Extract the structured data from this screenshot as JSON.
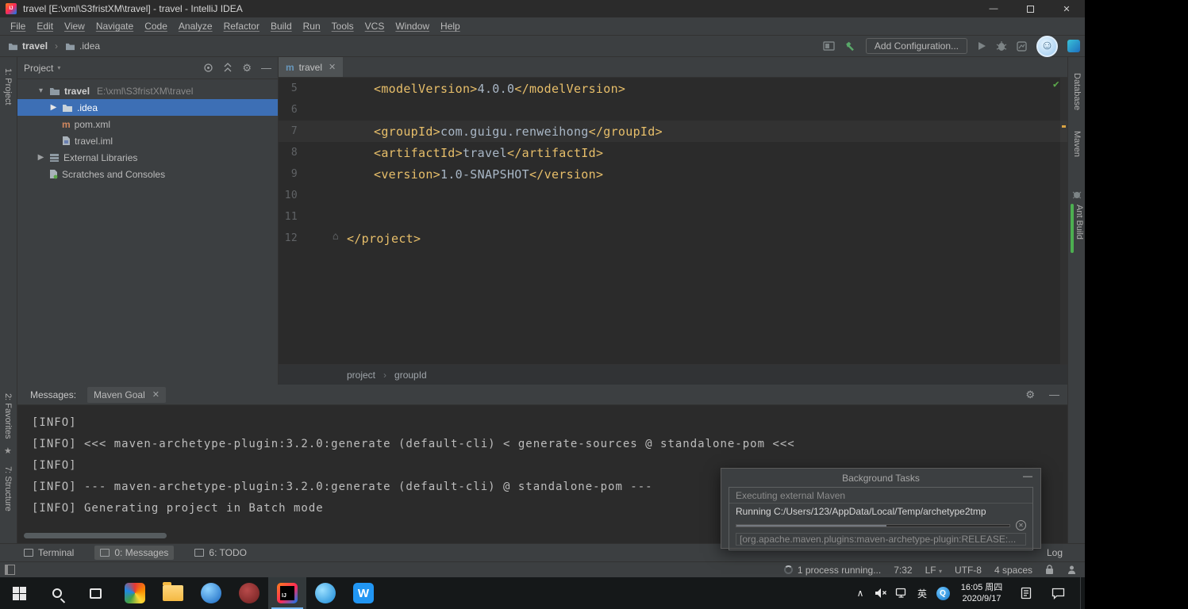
{
  "colors": {
    "xml-tag": "#e8bf6a",
    "code-text": "#a9b7c6",
    "ok-green": "#5ba74a",
    "bulb-yellow": "#f3c53f",
    "taskbar-accent": "#75b6f1"
  },
  "title_bar": {
    "title": "travel [E:\\xml\\S3fristXM\\travel] - travel - IntelliJ IDEA"
  },
  "menu_bar": {
    "items": [
      "File",
      "Edit",
      "View",
      "Navigate",
      "Code",
      "Analyze",
      "Refactor",
      "Build",
      "Run",
      "Tools",
      "VCS",
      "Window",
      "Help"
    ]
  },
  "nav_bar": {
    "crumb_project": "travel",
    "crumb_folder": ".idea",
    "add_configuration_label": "Add Configuration..."
  },
  "left_stripe": {
    "project": "1: Project",
    "favorites": "2: Favorites",
    "structure": "7: Structure"
  },
  "right_stripe": {
    "database": "Database",
    "maven": "Maven",
    "ant_build": "Ant Build"
  },
  "project_panel": {
    "header_label": "Project",
    "tree": [
      {
        "label": "travel",
        "hint": "E:\\xml\\S3fristXM\\travel"
      },
      {
        "label": ".idea"
      },
      {
        "label": "pom.xml"
      },
      {
        "label": "travel.iml"
      },
      {
        "label": "External Libraries"
      },
      {
        "label": "Scratches and Consoles"
      }
    ]
  },
  "editor": {
    "tab_label": "travel",
    "lines": [
      {
        "num": "5",
        "open": "<modelVersion>",
        "value": "4.0.0",
        "close": "</modelVersion>"
      },
      {
        "num": "6"
      },
      {
        "num": "7",
        "open": "<groupId>",
        "value": "com.guigu.renweihong",
        "close": "</groupId>"
      },
      {
        "num": "8",
        "open": "<artifactId>",
        "value": "travel",
        "close": "</artifactId>"
      },
      {
        "num": "9",
        "open": "<version>",
        "value": "1.0-SNAPSHOT",
        "close": "</version>"
      },
      {
        "num": "10"
      },
      {
        "num": "11"
      },
      {
        "num": "12",
        "tag": "</project>"
      }
    ],
    "breadcrumbs": {
      "first": "project",
      "second": "groupId"
    }
  },
  "messages_panel": {
    "label": "Messages:",
    "tab_label": "Maven Goal",
    "lines": [
      "[INFO]",
      "[INFO] <<< maven-archetype-plugin:3.2.0:generate (default-cli) < generate-sources @ standalone-pom <<<",
      "[INFO]",
      "[INFO] --- maven-archetype-plugin:3.2.0:generate (default-cli) @ standalone-pom ---",
      "[INFO] Generating project in Batch mode"
    ]
  },
  "background_tasks": {
    "title": "Background Tasks",
    "group_label": "Executing external Maven",
    "running_text": "Running C:/Users/123/AppData/Local/Temp/archetype2tmp",
    "detail_text": "[org.apache.maven.plugins:maven-archetype-plugin:RELEASE:..."
  },
  "tool_bar": {
    "terminal": "Terminal",
    "messages": "0: Messages",
    "todo": "6: TODO",
    "log": "Log"
  },
  "status_bar": {
    "process": "1 process running...",
    "position": "7:32",
    "line_separator": "LF",
    "encoding": "UTF-8",
    "indent": "4 spaces"
  },
  "taskbar": {
    "ime": "英",
    "clock_time": "16:05 周四",
    "clock_date": "2020/9/17"
  }
}
